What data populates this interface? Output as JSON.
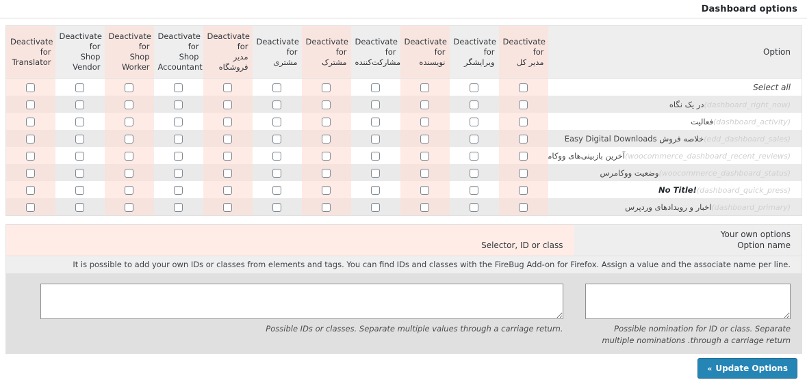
{
  "topbar": {
    "title": "Dashboard options"
  },
  "options_table": {
    "option_column_header": "Option",
    "columns": [
      {
        "label_en": "Deactivate\nfor",
        "label_role": "Translator",
        "highlight": true
      },
      {
        "label_en": "Deactivate\nfor",
        "label_role": "Shop\nVendor",
        "highlight": false
      },
      {
        "label_en": "Deactivate\nfor",
        "label_role": "Shop\nWorker",
        "highlight": true
      },
      {
        "label_en": "Deactivate\nfor",
        "label_role": "Shop\nAccountant",
        "highlight": false
      },
      {
        "label_en": "Deactivate\nfor",
        "label_role": "مدیر\nفروشگاه",
        "highlight": true
      },
      {
        "label_en": "Deactivate\nfor",
        "label_role": "مشتری",
        "highlight": false
      },
      {
        "label_en": "Deactivate\nfor",
        "label_role": "مشترک",
        "highlight": true
      },
      {
        "label_en": "Deactivate\nfor",
        "label_role": "مشارکت‌کننده",
        "highlight": false
      },
      {
        "label_en": "Deactivate\nfor",
        "label_role": "نویسنده",
        "highlight": true
      },
      {
        "label_en": "Deactivate\nfor",
        "label_role": "ویرایشگر",
        "highlight": false
      },
      {
        "label_en": "Deactivate\nfor",
        "label_role": "مدیر کل",
        "highlight": true
      }
    ],
    "select_all_label": "Select all",
    "rows": [
      {
        "name": "در یک نگاه",
        "id": "(dashboard_right_now)",
        "no_title": false
      },
      {
        "name": "فعالیت",
        "id": "(dashboard_activity)",
        "no_title": false
      },
      {
        "name": "خلاصه فروش Easy Digital Downloads",
        "id": "(edd_dashboard_sales)",
        "no_title": false
      },
      {
        "name": "آخرین بازبینی‌های ووکامرس",
        "id": "(woocommerce_dashboard_recent_reviews)",
        "no_title": false
      },
      {
        "name": "وضعیت ووکامرس",
        "id": "(woocommerce_dashboard_status)",
        "no_title": false
      },
      {
        "name": "!No Title",
        "id": "(dashboard_quick_press)",
        "no_title": true
      },
      {
        "name": "اخبار و رویدادهای وردپرس",
        "id": "(dashboard_primary)",
        "no_title": false
      }
    ]
  },
  "own_options": {
    "header_left": "Selector, ID or class",
    "header_right_line1": "Your own options",
    "header_right_line2": "Option name",
    "description": ".It is possible to add your own IDs or classes from elements and tags. You can find IDs and classes with the FireBug Add-on for Firefox. Assign a value and the associate name per line",
    "selector_textarea_value": "",
    "selector_textarea_placeholder": "",
    "selector_hint": ".Possible IDs or classes. Separate multiple values through a carriage return",
    "name_textarea_value": "",
    "name_textarea_placeholder": "",
    "name_hint": "Possible nomination for ID or class. Separate multiple nominations .through a carriage return"
  },
  "footer": {
    "update_button_label": "Update Options",
    "update_button_chevron": "«"
  },
  "colors": {
    "accent": "#2585b5",
    "highlight_column": "#ffdfd5",
    "header_bg": "#eeeeee",
    "alt_row_bg": "#eaeaea"
  }
}
